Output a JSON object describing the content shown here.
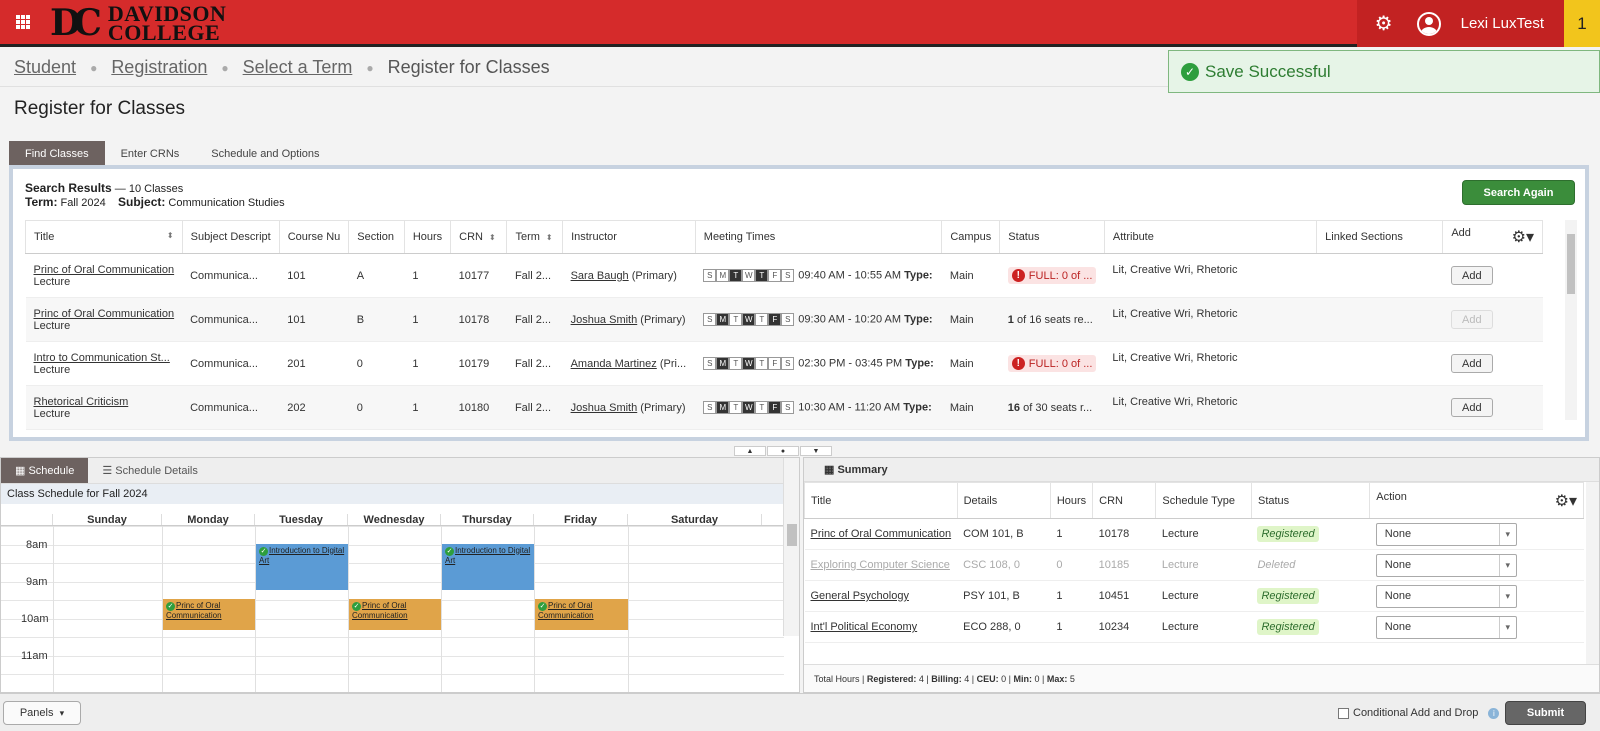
{
  "header": {
    "logo_mark": "DC",
    "logo_line1": "DAVIDSON",
    "logo_line2": "COLLEGE",
    "user_name": "Lexi LuxTest",
    "notification_count": "1"
  },
  "breadcrumb": [
    "Student",
    "Registration",
    "Select a Term",
    "Register for Classes"
  ],
  "toast": "Save Successful",
  "page_title": "Register for Classes",
  "tabs": [
    "Find Classes",
    "Enter CRNs",
    "Schedule and Options"
  ],
  "search": {
    "title": "Search Results",
    "count": "— 10 Classes",
    "term_label": "Term:",
    "term": "Fall 2024",
    "subject_label": "Subject:",
    "subject": "Communication Studies",
    "again_button": "Search Again"
  },
  "results_columns": [
    "Title",
    "Subject Descript",
    "Course Nu",
    "Section",
    "Hours",
    "CRN",
    "Term",
    "Instructor",
    "Meeting Times",
    "Campus",
    "Status",
    "Attribute",
    "Linked Sections",
    "Add"
  ],
  "results": [
    {
      "title": "Princ of Oral Communication",
      "type": "Lecture",
      "subject": "Communica...",
      "course": "101",
      "section": "A",
      "hours": "1",
      "crn": "10177",
      "term": "Fall 2...",
      "instructor": "Sara Baugh",
      "instructor_role": "(Primary)",
      "time": "09:40 AM - 10:55 AM",
      "type_label": "Type:",
      "campus": "Main",
      "status_full": true,
      "status_a": "FULL",
      "status_b": ": 0 of ...",
      "attribute": "Lit, Creative Wri, Rhetoric",
      "add": "Add",
      "add_disabled": false,
      "days_on": [
        2,
        4
      ]
    },
    {
      "title": "Princ of Oral Communication",
      "type": "Lecture",
      "subject": "Communica...",
      "course": "101",
      "section": "B",
      "hours": "1",
      "crn": "10178",
      "term": "Fall 2...",
      "instructor": "Joshua Smith",
      "instructor_role": "(Primary)",
      "time": "09:30 AM - 10:20 AM",
      "type_label": "Type:",
      "campus": "Main",
      "status_full": false,
      "status_a": "1",
      "status_b": " of 16 seats re...",
      "attribute": "Lit, Creative Wri, Rhetoric",
      "add": "Add",
      "add_disabled": true,
      "days_on": [
        1,
        3,
        5
      ]
    },
    {
      "title": "Intro to Communication St...",
      "type": "Lecture",
      "subject": "Communica...",
      "course": "201",
      "section": "0",
      "hours": "1",
      "crn": "10179",
      "term": "Fall 2...",
      "instructor": "Amanda Martinez",
      "instructor_role": "(Pri...",
      "time": "02:30 PM - 03:45 PM",
      "type_label": "Type:",
      "campus": "Main",
      "status_full": true,
      "status_a": "FULL",
      "status_b": ": 0 of ...",
      "attribute": "Lit, Creative Wri, Rhetoric",
      "add": "Add",
      "add_disabled": false,
      "days_on": [
        1,
        3
      ]
    },
    {
      "title": "Rhetorical Criticism",
      "type": "Lecture",
      "subject": "Communica...",
      "course": "202",
      "section": "0",
      "hours": "1",
      "crn": "10180",
      "term": "Fall 2...",
      "instructor": "Joshua Smith",
      "instructor_role": "(Primary)",
      "time": "10:30 AM - 11:20 AM",
      "type_label": "Type: ",
      "campus": "Main",
      "status_full": false,
      "status_a": "16",
      "status_b": " of 30 seats r...",
      "attribute": "Lit, Creative Wri, Rhetoric",
      "add": "Add",
      "add_disabled": false,
      "days_on": [
        1,
        3,
        5
      ]
    }
  ],
  "day_letters": [
    "S",
    "M",
    "T",
    "W",
    "T",
    "F",
    "S"
  ],
  "schedule": {
    "tabs": [
      "Schedule",
      "Schedule Details"
    ],
    "title": "Class Schedule for Fall 2024",
    "days": [
      "Sunday",
      "Monday",
      "Tuesday",
      "Wednesday",
      "Thursday",
      "Friday",
      "Saturday"
    ],
    "times": [
      "8am",
      "9am",
      "10am",
      "11am"
    ],
    "events": [
      {
        "label": "Introduction to Digital Art",
        "day": 2,
        "start": 8.0,
        "end": 9.25,
        "color": "#5b9bd5"
      },
      {
        "label": "Introduction to Digital Art",
        "day": 4,
        "start": 8.0,
        "end": 9.25,
        "color": "#5b9bd5"
      },
      {
        "label": "Princ of Oral Communication",
        "day": 1,
        "start": 9.5,
        "end": 10.333,
        "color": "#e0a449"
      },
      {
        "label": "Princ of Oral Communication",
        "day": 3,
        "start": 9.5,
        "end": 10.333,
        "color": "#e0a449"
      },
      {
        "label": "Princ of Oral Communication",
        "day": 5,
        "start": 9.5,
        "end": 10.333,
        "color": "#e0a449"
      }
    ]
  },
  "summary": {
    "title": "Summary",
    "columns": [
      "Title",
      "Details",
      "Hours",
      "CRN",
      "Schedule Type",
      "Status",
      "Action"
    ],
    "rows": [
      {
        "title": "Princ of Oral Communication",
        "details": "COM 101, B",
        "hours": "1",
        "crn": "10178",
        "stype": "Lecture",
        "status": "Registered",
        "action": "None",
        "deleted": false
      },
      {
        "title": "Exploring Computer Science",
        "details": "CSC 108, 0",
        "hours": "0",
        "crn": "10185",
        "stype": "Lecture",
        "status": "Deleted",
        "action": "None",
        "deleted": true
      },
      {
        "title": "General Psychology",
        "details": "PSY 101, B",
        "hours": "1",
        "crn": "10451",
        "stype": "Lecture",
        "status": "Registered",
        "action": "None",
        "deleted": false
      },
      {
        "title": "Int'l Political Economy",
        "details": "ECO 288, 0",
        "hours": "1",
        "crn": "10234",
        "stype": "Lecture",
        "status": "Registered",
        "action": "None",
        "deleted": false
      }
    ],
    "totals": {
      "prefix": "Total Hours | ",
      "registered_label": "Registered:",
      "registered": "4",
      "billing_label": "Billing:",
      "billing": "4",
      "ceu_label": "CEU:",
      "ceu": "0",
      "min_label": "Min:",
      "min": "0",
      "max_label": "Max:",
      "max": "5"
    }
  },
  "footer": {
    "panels": "Panels",
    "conditional": "Conditional Add and Drop",
    "submit": "Submit"
  },
  "colors": {
    "brand_red": "#d52b2b",
    "notification_yellow": "#f2c51c",
    "success_green": "#2e9e3e",
    "event_blue": "#5b9bd5",
    "event_orange": "#e0a449"
  }
}
